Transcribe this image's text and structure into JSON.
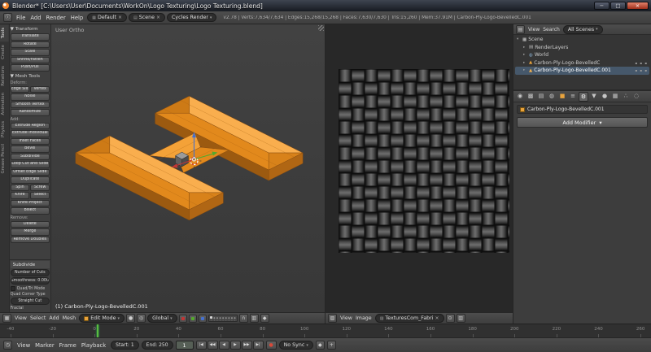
{
  "window": {
    "title": "Blender* [C:\\Users\\User\\Documents\\WorkOn\\Logo Texturing\\Logo Texturing.blend]",
    "controls": {
      "minimize": "−",
      "maximize": "□",
      "close": "×"
    }
  },
  "info_bar": {
    "menus": [
      "File",
      "Add",
      "Render",
      "Help"
    ],
    "layout": "Default",
    "scene": "Scene",
    "engine": "Cycles Render",
    "stats": "v2.78 | Verts:7,634/7,634 | Edges:15,268/15,268 | Faces:7,630/7,630 | Tris:15,260 | Mem:37.91M | Carbon-Ply-Logo-BevelledC.001"
  },
  "tool_shelf": {
    "tabs": [
      "Tools",
      "Create",
      "Relations",
      "Animation",
      "Physics",
      "Grease Pencil"
    ],
    "sections": [
      {
        "title": "Transform",
        "groups": [
          {
            "label": "",
            "rows": [
              [
                "Translate"
              ],
              [
                "Rotate"
              ],
              [
                "Scale"
              ],
              [
                "Shrink/Fatten"
              ],
              [
                "Push/Pull"
              ]
            ]
          }
        ]
      },
      {
        "title": "Mesh Tools",
        "groups": [
          {
            "label": "Deform:",
            "rows": [
              [
                "Edge Slide",
                "Vertex"
              ],
              [
                "Noise"
              ],
              [
                "Smooth Vertex"
              ],
              [
                "Randomize"
              ]
            ]
          },
          {
            "label": "Add:",
            "rows": [
              [
                "Extrude Region"
              ],
              [
                "Extrude Individual"
              ],
              [
                "Inset Faces"
              ],
              [
                "Bevel"
              ],
              [
                "Subdivide"
              ],
              [
                "Loop Cut and Slide"
              ],
              [
                "Offset Edge Slide"
              ],
              [
                "Duplicate"
              ],
              [
                "Spin",
                "Screw"
              ],
              [
                "Knife",
                "Select"
              ],
              [
                "Knife Project"
              ],
              [
                "Bisect"
              ]
            ]
          },
          {
            "label": "Remove:",
            "rows": [
              [
                "Delete"
              ],
              [
                "Merge"
              ],
              [
                "Remove Doubles"
              ]
            ]
          }
        ]
      }
    ],
    "redo": {
      "title": "Subdivide",
      "fields": [
        "Number of Cuts",
        "Smoothness: 0.000"
      ],
      "checkbox": "Quad/Tri Mode",
      "corner_label": "Quad Corner Type",
      "corner_value": "Straight Cut",
      "fractal_label": "Fractal"
    }
  },
  "viewport": {
    "view_label": "User Ortho",
    "object_label": "(1) Carbon-Ply-Logo-BevelledC.001",
    "header": {
      "menus": [
        "View",
        "Select",
        "Add",
        "Mesh"
      ],
      "mode": "Edit Mode",
      "orientation": "Global"
    }
  },
  "uv_editor": {
    "header": {
      "menus": [
        "View",
        "Image"
      ],
      "image_name": "TexturesCom_Fabri"
    }
  },
  "outliner": {
    "header": {
      "menus": [
        "View",
        "Search"
      ],
      "filter": "All Scenes"
    },
    "items": [
      {
        "label": "Scene",
        "depth": 0,
        "expand": "▾",
        "glyph": "▦",
        "color": "#cfcfcf",
        "restrict": false,
        "selected": false
      },
      {
        "label": "RenderLayers",
        "depth": 1,
        "expand": "▸",
        "glyph": "▤",
        "color": "#b8b8b8",
        "restrict": false,
        "selected": false
      },
      {
        "label": "World",
        "depth": 1,
        "expand": "▸",
        "glyph": "◍",
        "color": "#86aac8",
        "restrict": false,
        "selected": false
      },
      {
        "label": "Carbon-Ply-Logo-BevelledC",
        "depth": 1,
        "expand": "▸",
        "glyph": "▲",
        "color": "#e8a33d",
        "restrict": true,
        "selected": false
      },
      {
        "label": "Carbon-Ply-Logo-BevelledC.001",
        "depth": 1,
        "expand": "▸",
        "glyph": "▲",
        "color": "#f0b050",
        "restrict": true,
        "selected": true
      }
    ]
  },
  "properties": {
    "tabs": [
      {
        "name": "render",
        "glyph": "◉",
        "active": false
      },
      {
        "name": "render-layers",
        "glyph": "▩",
        "active": false
      },
      {
        "name": "scene",
        "glyph": "▤",
        "active": false
      },
      {
        "name": "world",
        "glyph": "◍",
        "active": false
      },
      {
        "name": "object",
        "glyph": "■",
        "active": false,
        "color": "#e8a33d"
      },
      {
        "name": "constraints",
        "glyph": "≡",
        "active": false
      },
      {
        "name": "modifiers",
        "glyph": "⚙",
        "active": true
      },
      {
        "name": "object-data",
        "glyph": "▼",
        "active": false
      },
      {
        "name": "material",
        "glyph": "●",
        "active": false
      },
      {
        "name": "texture",
        "glyph": "▦",
        "active": false
      },
      {
        "name": "particles",
        "glyph": "∴",
        "active": false
      },
      {
        "name": "physics",
        "glyph": "◌",
        "active": false
      }
    ],
    "breadcrumb": "Carbon-Ply-Logo-BevelledC.001",
    "add_modifier": "Add Modifier"
  },
  "timeline": {
    "ruler": {
      "min": -45,
      "max": 265,
      "current_frame": 1,
      "labels": [
        -40,
        -20,
        0,
        20,
        40,
        60,
        80,
        100,
        120,
        140,
        160,
        180,
        200,
        220,
        240,
        260
      ]
    },
    "header": {
      "menus": [
        "View",
        "Marker",
        "Frame",
        "Playback"
      ],
      "start_label": "Start:",
      "start_value": "1",
      "end_label": "End:",
      "end_value": "250",
      "frame_value": "1",
      "transport": [
        "|◀",
        "◀◀",
        "◀",
        "▶",
        "▶▶",
        "▶|"
      ],
      "record": "●",
      "sync": "No Sync"
    }
  },
  "colors": {
    "accent_orange": "#e87d0d",
    "playhead_green": "#5dbb3f",
    "selection": "#46586b"
  }
}
